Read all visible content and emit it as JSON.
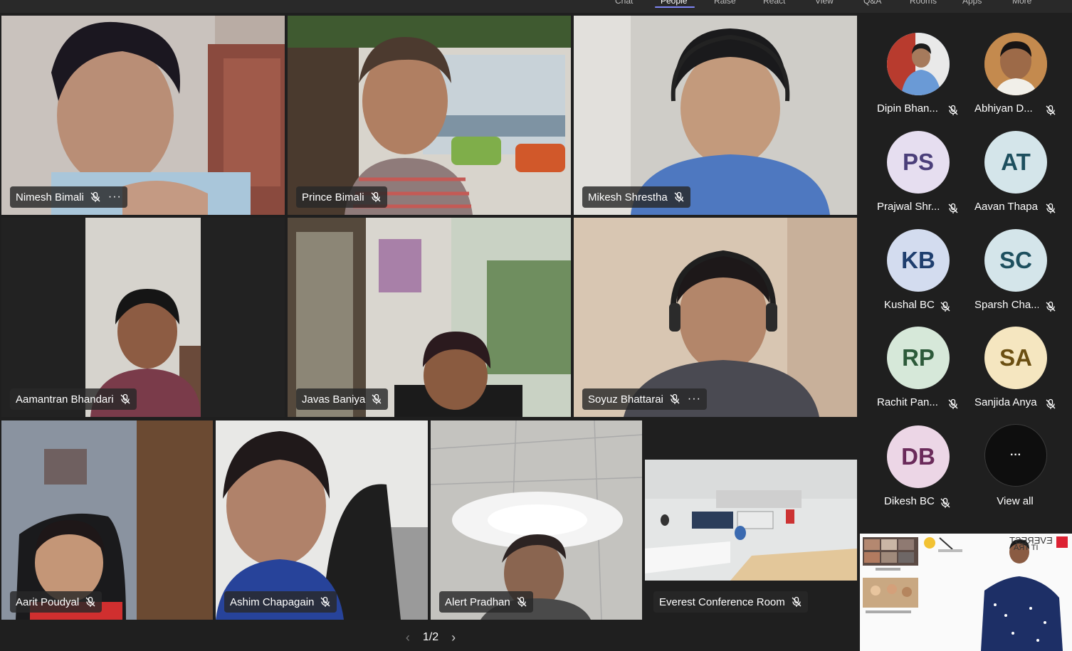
{
  "top_tabs": [
    {
      "label": "Chat"
    },
    {
      "label": "People",
      "active": true
    },
    {
      "label": "Raise"
    },
    {
      "label": "React"
    },
    {
      "label": "View"
    },
    {
      "label": "Q&A"
    },
    {
      "label": "Rooms"
    },
    {
      "label": "Apps"
    },
    {
      "label": "More"
    }
  ],
  "tiles": [
    {
      "name": "Nimesh Bimali",
      "muted": true,
      "has_more": true
    },
    {
      "name": "Prince Bimali",
      "muted": true,
      "has_more": false
    },
    {
      "name": "Mikesh Shrestha",
      "muted": true,
      "has_more": false
    },
    {
      "name": "Aamantran Bhandari",
      "muted": true,
      "has_more": false
    },
    {
      "name": "Javas Baniya",
      "muted": true,
      "has_more": false
    },
    {
      "name": "Soyuz Bhattarai",
      "muted": true,
      "has_more": true
    },
    {
      "name": "Aarit Poudyal",
      "muted": true,
      "has_more": false
    },
    {
      "name": "Ashim Chapagain",
      "muted": true,
      "has_more": false
    },
    {
      "name": "Alert Pradhan",
      "muted": true,
      "has_more": false
    },
    {
      "name": "Everest Conference Room",
      "muted": true,
      "has_more": false
    }
  ],
  "pager": {
    "text": "1/2"
  },
  "more_glyph": "···",
  "people": [
    {
      "name": "Dipin Bhan...",
      "initials": "",
      "photo": true,
      "bg": "#5a7fb0"
    },
    {
      "name": "Abhiyan D...",
      "initials": "",
      "photo": true,
      "bg": "#a07048"
    },
    {
      "name": "Prajwal Shr...",
      "initials": "PS",
      "bg": "#e6def0",
      "fg": "#4b3f7a"
    },
    {
      "name": "Aavan Thapa",
      "initials": "AT",
      "bg": "#d4e5ea",
      "fg": "#1d4f5e"
    },
    {
      "name": "Kushal BC",
      "initials": "KB",
      "bg": "#d3dcef",
      "fg": "#1e3e6e"
    },
    {
      "name": "Sparsh Cha...",
      "initials": "SC",
      "bg": "#d4e5ea",
      "fg": "#1d4f5e"
    },
    {
      "name": "Rachit Pan...",
      "initials": "RP",
      "bg": "#d6e8d9",
      "fg": "#2d5a3a"
    },
    {
      "name": "Sanjida Anya",
      "initials": "SA",
      "bg": "#f5e6c0",
      "fg": "#6b4f12"
    },
    {
      "name": "Dikesh BC",
      "initials": "DB",
      "bg": "#ecd6e6",
      "fg": "#6a2a5a"
    }
  ],
  "view_all": {
    "glyph": "···",
    "label": "View all"
  },
  "share_overlay": {
    "title_line1": "EVEREST",
    "title_line2": "IT TRA"
  }
}
